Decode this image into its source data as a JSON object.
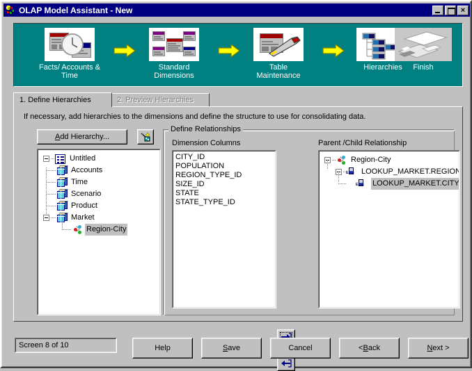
{
  "window": {
    "title": "OLAP Model Assistant - New",
    "app_icon": "olap-cube-icon",
    "minimize_label": "",
    "maximize_label": "",
    "close_label": "×"
  },
  "banner": {
    "background_color": "#008080",
    "steps": [
      {
        "id": "facts-accounts-time",
        "label": "Facts/ Accounts &\nTime",
        "icon": "calendar-clock-icon"
      },
      {
        "id": "standard-dimensions",
        "label": "Standard\nDimensions",
        "icon": "dimension-tables-icon"
      },
      {
        "id": "table-maintenance",
        "label": "Table\nMaintenance",
        "icon": "wrench-table-icon"
      },
      {
        "id": "hierarchies",
        "label": "Hierarchies",
        "icon": "hierarchy-tree-icon"
      },
      {
        "id": "finish",
        "label": "Finish",
        "icon": "finish-sheets-icon"
      }
    ],
    "arrows": [
      "arrow-right-icon",
      "arrow-right-icon",
      "arrow-right-icon"
    ],
    "arrow_color": "#ffff00"
  },
  "tabs": [
    {
      "id": "define-hierarchies",
      "label": "1. Define Hierarchies",
      "selected": true,
      "enabled": true
    },
    {
      "id": "preview-hierarchies",
      "label": "2. Preview Hierarchies",
      "selected": false,
      "enabled": false
    }
  ],
  "page": {
    "instruction": "If necessary, add hierarchies to the dimensions and define the structure to use for consolidating data.",
    "add_hierarchy_button": {
      "label_pre": "A",
      "label_post": "dd Hierarchy..."
    },
    "filter_button": {
      "icon": "filter-wand-icon"
    }
  },
  "model_tree": {
    "root": {
      "label": "Untitled",
      "icon": "model-icon",
      "expanded": true
    },
    "children": [
      {
        "label": "Accounts",
        "icon": "cube-icon",
        "expanded": false,
        "selected": false
      },
      {
        "label": "Time",
        "icon": "cube-icon",
        "expanded": false,
        "selected": false
      },
      {
        "label": "Scenario",
        "icon": "cube-icon",
        "expanded": false,
        "selected": false
      },
      {
        "label": "Product",
        "icon": "cube-icon",
        "expanded": false,
        "selected": false
      },
      {
        "label": "Market",
        "icon": "cube-icon",
        "expanded": true,
        "selected": false,
        "children": [
          {
            "label": "Region-City",
            "icon": "hierarchy-icon",
            "selected": true
          }
        ]
      }
    ]
  },
  "relationships": {
    "group_title": "Define Relationships",
    "dimension_columns": {
      "label": "Dimension Columns",
      "items": [
        "CITY_ID",
        "POPULATION",
        "REGION_TYPE_ID",
        "SIZE_ID",
        "STATE",
        "STATE_TYPE_ID"
      ],
      "selected": null
    },
    "parent_child": {
      "label": "Parent /Child Relationship",
      "nodes": [
        {
          "label": "Region-City",
          "icon": "hierarchy-icon",
          "level": 0,
          "expanded": true,
          "selected": false
        },
        {
          "label": "LOOKUP_MARKET.REGION",
          "icon": "column-icon",
          "level": 1,
          "expanded": true,
          "selected": false
        },
        {
          "label": "LOOKUP_MARKET.CITY",
          "icon": "column-icon",
          "level": 2,
          "expanded": false,
          "selected": true
        }
      ]
    },
    "move_right_button": {
      "icon": "arrow-right-into-box-icon",
      "focused": true
    },
    "move_left_button": {
      "icon": "arrow-left-into-box-icon",
      "focused": false
    }
  },
  "footer": {
    "screen_counter": "Screen 8 of 10",
    "buttons": [
      {
        "id": "help",
        "pre": "",
        "mnemonic": "",
        "post": "Help"
      },
      {
        "id": "save",
        "pre": "",
        "mnemonic": "S",
        "post": "ave"
      },
      {
        "id": "cancel",
        "pre": "",
        "mnemonic": "",
        "post": "Cancel"
      },
      {
        "id": "back",
        "pre": "< ",
        "mnemonic": "B",
        "post": "ack"
      },
      {
        "id": "next",
        "pre": "",
        "mnemonic": "N",
        "post": "ext >"
      }
    ]
  },
  "colors": {
    "titlebar": "#000080",
    "banner": "#008080",
    "face": "#c0c0c0",
    "selection": "#c0c0c0"
  }
}
